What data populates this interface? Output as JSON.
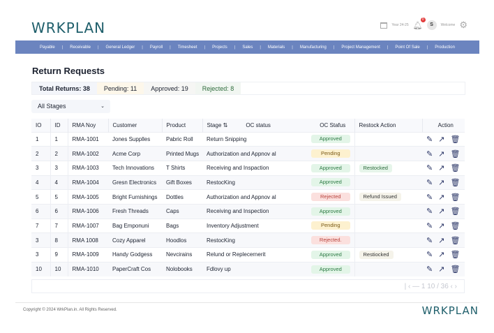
{
  "header": {
    "logo": "WRKPLAN",
    "year": "Year 24-25",
    "notifications": "0",
    "avatar": "S",
    "welcome": "Welcome"
  },
  "nav": [
    "Payable",
    "Receivable",
    "General Ledger",
    "Payroll",
    "Timesheet",
    "Projects",
    "Sales",
    "Materials",
    "Manufacturing",
    "Project Management",
    "Point Of Sale",
    "Production"
  ],
  "page_title": "Return Requests",
  "summary": {
    "total": "Total Returns: 38",
    "pending": "Pending: 11",
    "approved": "Approved: 19",
    "rejected": "Rejected: 8"
  },
  "filter": {
    "selected": "All Stages"
  },
  "table": {
    "headers": [
      "IO",
      "ID",
      "RMA Noy",
      "Customer",
      "Product",
      "Stage ⇅",
      "OC status",
      "OC Stafus",
      "Restock Action",
      "Action"
    ],
    "rows": [
      [
        "1",
        "1",
        "RMA-1001",
        "Jones Supplles",
        "Pabric Roll",
        "Return Snipping",
        "Approved",
        ""
      ],
      [
        "2",
        "2",
        "RMA-1002",
        "Acme Corp",
        "Printed Mugs",
        "Authorization and Appnov al",
        "Pending",
        ""
      ],
      [
        "3",
        "3",
        "RMA-1003",
        "Tech Innovations",
        "T Shirts",
        "Receiving and Inspaction",
        "Approved",
        "Restocked"
      ],
      [
        "4",
        "4",
        "RMA-1004",
        "Gresn Electronics",
        "Gift Boxes",
        "RestocKing",
        "Approved",
        ""
      ],
      [
        "5",
        "5",
        "RMA-1005",
        "Bright Furnishings",
        "Dottles",
        "Authorization and Appnov al",
        "Rejected",
        "Refund Issued"
      ],
      [
        "6",
        "6",
        "RMA-1006",
        "Fresh Threads",
        "Caps",
        "Receiving and Inspection",
        "Approved",
        ""
      ],
      [
        "7",
        "7",
        "RMA-1007",
        "Bag Emponuni",
        "Bags",
        "Inventory Adjustment",
        "Pending",
        ""
      ],
      [
        "3",
        "8",
        "RMA 1008",
        "Cozy Apparel",
        "Hoodlos",
        "RestocKing",
        "Rejected.",
        ""
      ],
      [
        "3",
        "9",
        "RMA-1009",
        "Handy Godgess",
        "Nevcirains",
        "Relund or Replecernerit",
        "Approved",
        "Restiocked"
      ],
      [
        "10",
        "10",
        "RMA-1010",
        "PaperCraft Cos",
        "Nolobooks",
        "Fdlovy up",
        "Approved",
        ""
      ]
    ]
  },
  "pagination": "| ‹ — 1 10 / 36 ‹ ›",
  "footer": {
    "copyright": "Copyright © 2024 WrkPlan.in. All Rights Reserved.",
    "logo": "WRKPLAN"
  },
  "colors": {
    "brand": "#1f5f6b",
    "nav": "#6b84bf"
  }
}
